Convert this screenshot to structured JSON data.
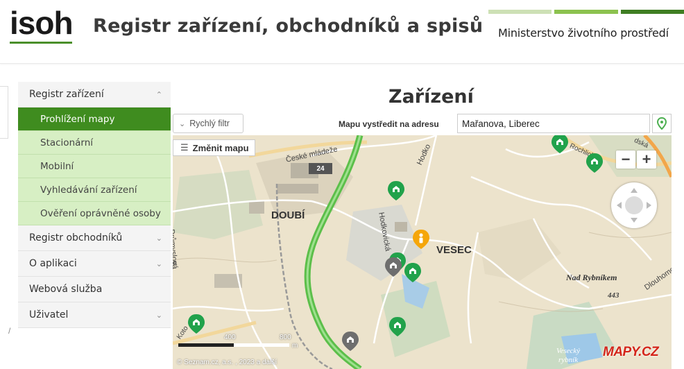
{
  "header": {
    "logo": "isoh",
    "title": "Registr zařízení, obchodníků a spisů",
    "ministry": "Ministerstvo životního prostředí",
    "ministry_bar_colors": [
      "#cde0b5",
      "#8cc24f",
      "#3f7e23"
    ]
  },
  "sidebar": {
    "registr_zarizeni": "Registr zařízení",
    "sub": [
      {
        "label": "Prohlížení mapy",
        "active": true
      },
      {
        "label": "Stacionární",
        "active": false
      },
      {
        "label": "Mobilní",
        "active": false
      },
      {
        "label": "Vyhledávání zařízení",
        "active": false
      },
      {
        "label": "Ověření oprávněné osoby",
        "active": false
      }
    ],
    "registr_obchodniku": "Registr obchodníků",
    "o_aplikaci": "O aplikaci",
    "webova_sluzba": "Webová služba",
    "uzivatel": "Uživatel",
    "chevron_up_icon": "chevron-up-icon",
    "chevron_down_icon": "chevron-down-icon"
  },
  "main": {
    "title": "Zařízení",
    "filter_label": "Rychlý filtr",
    "address_label": "Mapu vystředit na adresu",
    "address_value": "Mařanova, Liberec",
    "pin_icon": "location-pin-icon"
  },
  "map": {
    "change_map_label": "Změnit mapu",
    "zoom_out": "−",
    "zoom_in": "+",
    "labels": {
      "doubi": "DOUBÍ",
      "vesec": "VESEC",
      "prumyslova": "Průmyslová",
      "hodkovicka": "Hodkovická",
      "ceske_mladeze": "České mládeže",
      "nad_rybnikem": "Nad Rybníkem",
      "elev": "443",
      "rochlick": "Rochlick",
      "road_sign": "24",
      "dlouhomost": "Dlouhomo",
      "vesecky": "Vesecký",
      "rybnik": "rybník",
      "hodk_top": "Hodko",
      "koto": "Koto",
      "a_left": "a",
      "dska": "dská"
    },
    "scale": {
      "mid": "400",
      "end": "800",
      "unit": "m"
    },
    "copyright": "© Seznam.cz, a.s. , 2023 a  další",
    "logo": "MAPY.CZ",
    "colors": {
      "marker_green": "#21a24b",
      "marker_gray": "#6e6e6e",
      "person": "#f5a60a",
      "road_green": "#5cbf4a"
    }
  }
}
